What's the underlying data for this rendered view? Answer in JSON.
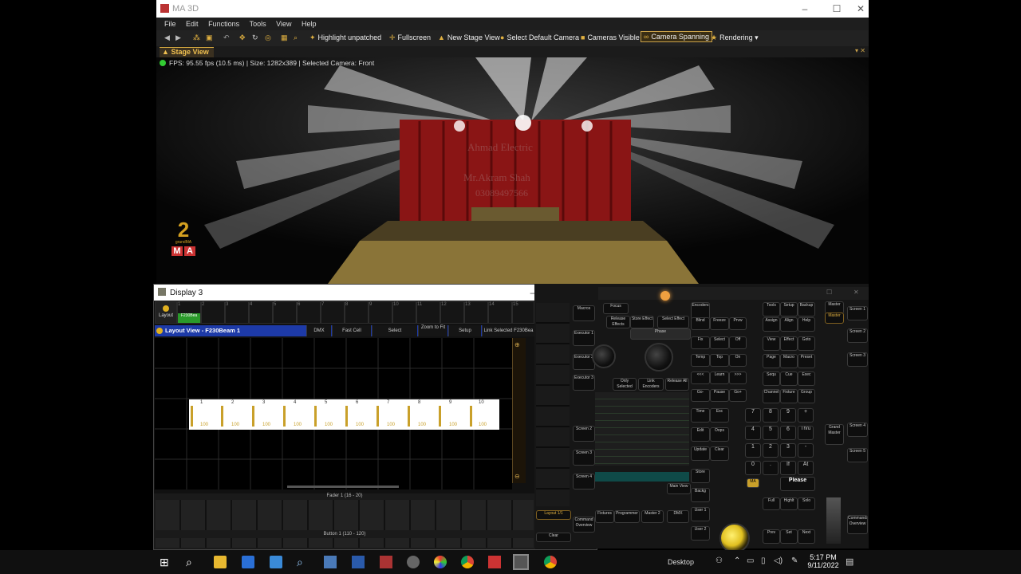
{
  "main_window": {
    "title": "MA 3D",
    "menu": [
      "File",
      "Edit",
      "Functions",
      "Tools",
      "View",
      "Help"
    ],
    "toolbar": {
      "highlight": "Highlight unpatched",
      "fullscreen": "Fullscreen",
      "new_stage_view": "New Stage View",
      "select_default_camera": "Select Default Camera",
      "cameras_visible": "Cameras Visible",
      "camera_spanning": "Camera Spanning",
      "rendering": "Rendering"
    },
    "tab": "Stage View",
    "status": "FPS: 95.55 fps (10.5 ms) | Size: 1282x389 | Selected Camera: Front",
    "watermark_line1": "Ahmad Electric",
    "watermark_line2": "Mr.Akram Shah",
    "watermark_line3": "03089497566"
  },
  "display3": {
    "title": "Display 3",
    "top_cells": [
      "Layout",
      "1",
      "2",
      "3",
      "4",
      "5",
      "6",
      "7",
      "8",
      "9",
      "10",
      "11",
      "12",
      "13",
      "14",
      "15"
    ],
    "pool_label": "F230Bea",
    "layout_view": {
      "title": "Layout View - F230Beam 1",
      "buttons": [
        "DMX",
        "Fast Cell",
        "Select",
        "Zoom to Fit",
        "Setup",
        "Link Selected F230Bea"
      ]
    },
    "fixtures": [
      {
        "id": "1",
        "val": "100"
      },
      {
        "id": "2",
        "val": "100"
      },
      {
        "id": "3",
        "val": "100"
      },
      {
        "id": "4",
        "val": "100"
      },
      {
        "id": "5",
        "val": "100"
      },
      {
        "id": "6",
        "val": "100"
      },
      {
        "id": "7",
        "val": "100"
      },
      {
        "id": "8",
        "val": "100"
      },
      {
        "id": "9",
        "val": "100"
      },
      {
        "id": "10",
        "val": "100"
      }
    ],
    "fader_label": "Fader 1 (16 - 20)",
    "button_label": "Button 1 (110 - 120)"
  },
  "console": {
    "left_keys": [
      "Macros",
      "Executor 1",
      "Executor 2",
      "Executor 3",
      "Screen 2",
      "Screen 3",
      "Screen 4",
      "Layout 1/1",
      "Command Overview",
      "Clear"
    ],
    "center_keys": [
      "Focus",
      "Release Effects",
      "Store Effect",
      "Select Effect",
      "Only Selected",
      "Link Encoders",
      "Release All",
      "Phase"
    ],
    "row_keys": [
      "Fixtures",
      "Programmer",
      "Master 2",
      "DMX",
      "Main View"
    ],
    "right_keys": [
      "Encoders",
      "Blind",
      "Freeze",
      "Prvw",
      "Fix",
      "Select",
      "Off",
      "Temp",
      "Top",
      "On",
      "<<<",
      "Learn",
      ">>>",
      "Go-",
      "Pause",
      "Go+",
      "Time",
      "Esc",
      "Edit",
      "Oops",
      "Update",
      "Clear",
      "Store",
      "Backg",
      "User 1",
      "User 2"
    ],
    "far_keys": [
      "Tools",
      "Setup",
      "Backup",
      "Assign",
      "Align",
      "Help",
      "View",
      "Effect",
      "Goto",
      "Page",
      "Macro",
      "Preset",
      "Sequ",
      "Cue",
      "Exec",
      "Channel",
      "Fixture",
      "Group",
      "Full",
      "Highlt",
      "Solo",
      "MA",
      "Please",
      "Prev",
      "Set",
      "Next"
    ],
    "numpad": [
      "7",
      "8",
      "9",
      "+",
      "4",
      "5",
      "6",
      "Thru",
      "1",
      "2",
      "3",
      "-",
      "0",
      ".",
      "If",
      "At"
    ],
    "side_keys": [
      "Master",
      "Screen 1",
      "Screen 2",
      "Screen 3",
      "Screen 4",
      "Screen 5",
      "Grand Master",
      "Commands Overview"
    ]
  },
  "taskbar": {
    "desktop": "Desktop",
    "time": "5:17 PM",
    "date": "9/11/2022"
  }
}
